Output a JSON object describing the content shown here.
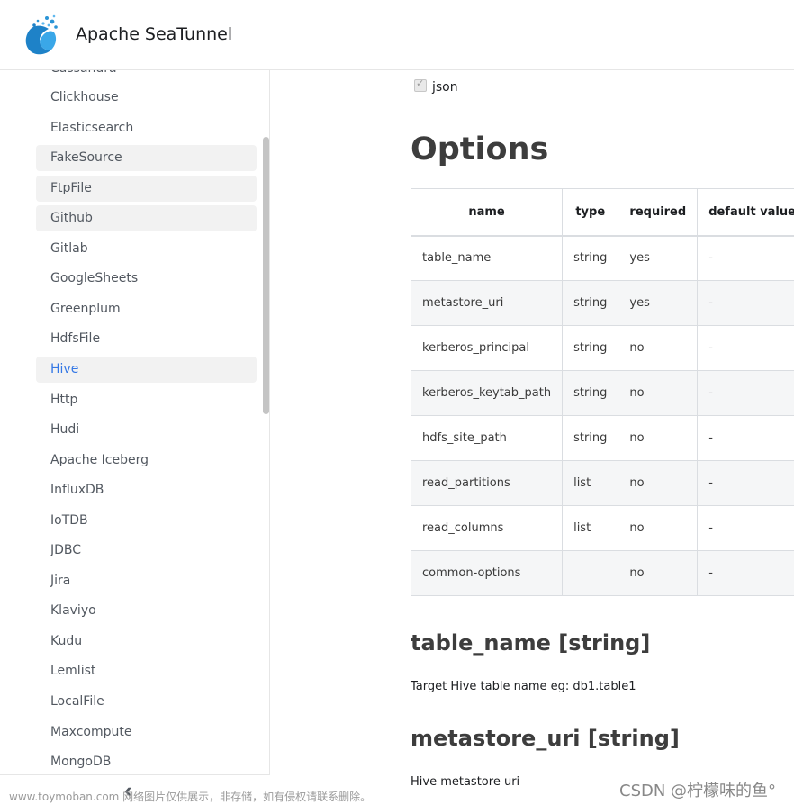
{
  "header": {
    "brand": "Apache SeaTunnel"
  },
  "sidebar": {
    "partial_top_item": "Cassandra",
    "items": [
      {
        "label": "Clickhouse",
        "state": "normal"
      },
      {
        "label": "Elasticsearch",
        "state": "normal"
      },
      {
        "label": "FakeSource",
        "state": "highlight"
      },
      {
        "label": "FtpFile",
        "state": "highlight"
      },
      {
        "label": "Github",
        "state": "highlight"
      },
      {
        "label": "Gitlab",
        "state": "normal"
      },
      {
        "label": "GoogleSheets",
        "state": "normal"
      },
      {
        "label": "Greenplum",
        "state": "normal"
      },
      {
        "label": "HdfsFile",
        "state": "normal"
      },
      {
        "label": "Hive",
        "state": "active"
      },
      {
        "label": "Http",
        "state": "normal"
      },
      {
        "label": "Hudi",
        "state": "normal"
      },
      {
        "label": "Apache Iceberg",
        "state": "normal"
      },
      {
        "label": "InfluxDB",
        "state": "normal"
      },
      {
        "label": "IoTDB",
        "state": "normal"
      },
      {
        "label": "JDBC",
        "state": "normal"
      },
      {
        "label": "Jira",
        "state": "normal"
      },
      {
        "label": "Klaviyo",
        "state": "normal"
      },
      {
        "label": "Kudu",
        "state": "normal"
      },
      {
        "label": "Lemlist",
        "state": "normal"
      },
      {
        "label": "LocalFile",
        "state": "normal"
      },
      {
        "label": "Maxcompute",
        "state": "normal"
      },
      {
        "label": "MongoDB",
        "state": "normal"
      }
    ],
    "collapse_icon": "double-chevron-left-icon"
  },
  "main": {
    "checkbox_label": "json",
    "options_title": "Options",
    "table": {
      "headers": [
        "name",
        "type",
        "required",
        "default value"
      ],
      "rows": [
        [
          "table_name",
          "string",
          "yes",
          "-"
        ],
        [
          "metastore_uri",
          "string",
          "yes",
          "-"
        ],
        [
          "kerberos_principal",
          "string",
          "no",
          "-"
        ],
        [
          "kerberos_keytab_path",
          "string",
          "no",
          "-"
        ],
        [
          "hdfs_site_path",
          "string",
          "no",
          "-"
        ],
        [
          "read_partitions",
          "list",
          "no",
          "-"
        ],
        [
          "read_columns",
          "list",
          "no",
          "-"
        ],
        [
          "common-options",
          "",
          "no",
          "-"
        ]
      ]
    },
    "sections": [
      {
        "title": "table_name [string]",
        "desc": "Target Hive table name eg: db1.table1"
      },
      {
        "title": "metastore_uri [string]",
        "desc": "Hive metastore uri"
      }
    ]
  },
  "watermark": {
    "left": "www.toymoban.com 网络图片仅供展示，非存储，如有侵权请联系删除。",
    "right": "CSDN @柠檬味的鱼°"
  },
  "colors": {
    "accent": "#3578e5",
    "highlight_bg": "#f2f2f2"
  }
}
